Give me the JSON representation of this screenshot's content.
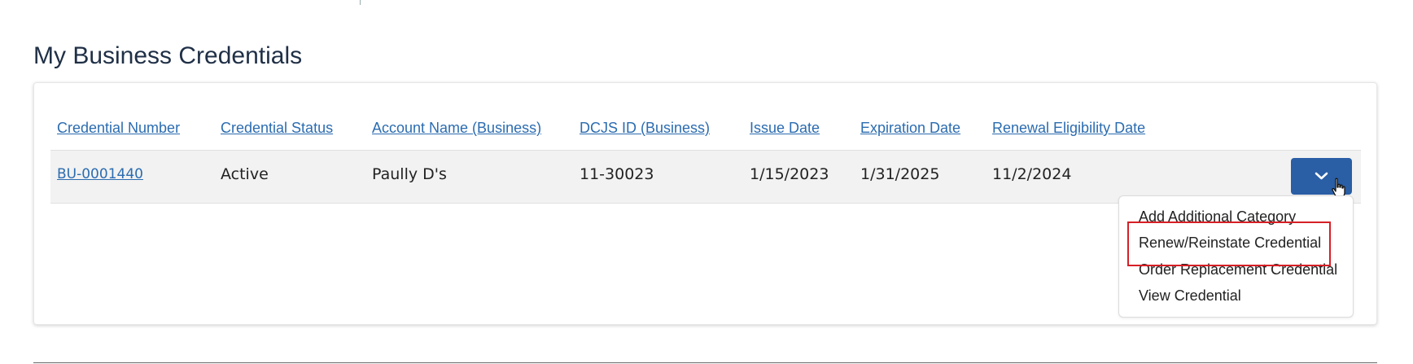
{
  "section": {
    "title": "My Business Credentials"
  },
  "table": {
    "headers": [
      "Credential Number",
      "Credential Status",
      "Account Name (Business)",
      "DCJS ID (Business)",
      "Issue Date",
      "Expiration Date",
      "Renewal Eligibility Date"
    ],
    "rows": [
      {
        "credential_number": "BU-0001440",
        "credential_status": "Active",
        "account_name": "Paully D's",
        "dcjs_id": "11-30023",
        "issue_date": "1/15/2023",
        "expiration_date": "1/31/2025",
        "renewal_eligibility_date": "11/2/2024"
      }
    ]
  },
  "actions_menu": {
    "button_icon": "chevron-down-icon",
    "items": [
      "Add Additional Category",
      "Renew/Reinstate Credential",
      "Order Replacement Credential",
      "View Credential"
    ],
    "highlighted_item_index": 1
  },
  "colors": {
    "link": "#2b6cb0",
    "button": "#2a5ea5",
    "highlight": "#d61f26",
    "title": "#1f2f46"
  }
}
